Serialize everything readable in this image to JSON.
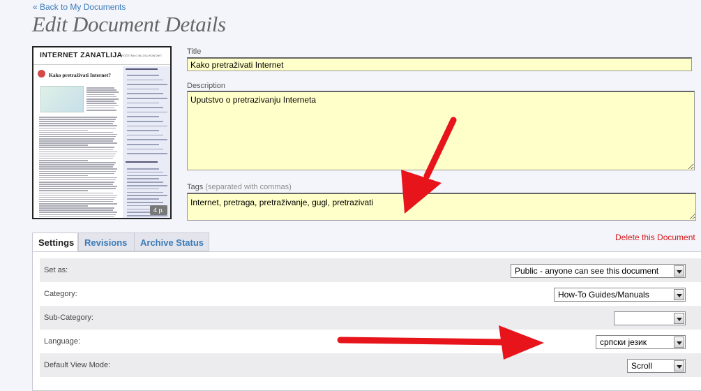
{
  "nav": {
    "back_link": "« Back to My Documents"
  },
  "page": {
    "title": "Edit Document Details"
  },
  "thumbnail": {
    "site_name": "INTERNET ZANATLIJA",
    "nav_text": "POČETNA  O BLOGU  KONTAKT",
    "doc_title": "Kako pretraživati Internet?",
    "page_count": "4 p."
  },
  "form": {
    "title_label": "Title",
    "title_value": "Kako pretraživati Internet",
    "description_label": "Description",
    "description_value": "Uputstvo o pretrazivanju Interneta",
    "tags_label": "Tags",
    "tags_hint": "(separated with commas)",
    "tags_value": "Internet, pretraga, pretraživanje, gugl, pretrazivati"
  },
  "tabs": [
    {
      "label": "Settings",
      "active": true
    },
    {
      "label": "Revisions",
      "active": false
    },
    {
      "label": "Archive Status",
      "active": false
    }
  ],
  "actions": {
    "delete_label": "Delete this Document"
  },
  "settings": [
    {
      "label": "Set as:",
      "value": "Public - anyone can see this document"
    },
    {
      "label": "Category:",
      "value": "How-To Guides/Manuals"
    },
    {
      "label": "Sub-Category:",
      "value": ""
    },
    {
      "label": "Language:",
      "value": "српски језик"
    },
    {
      "label": "Default View Mode:",
      "value": "Scroll"
    }
  ],
  "colors": {
    "link": "#3a7cb8",
    "delete": "#d11919",
    "input_bg": "#ffffc9",
    "arrow": "#e8141c"
  },
  "icons": {
    "select_arrow": "chevron-down-icon",
    "annotation_arrow": "red-arrow-icon"
  }
}
